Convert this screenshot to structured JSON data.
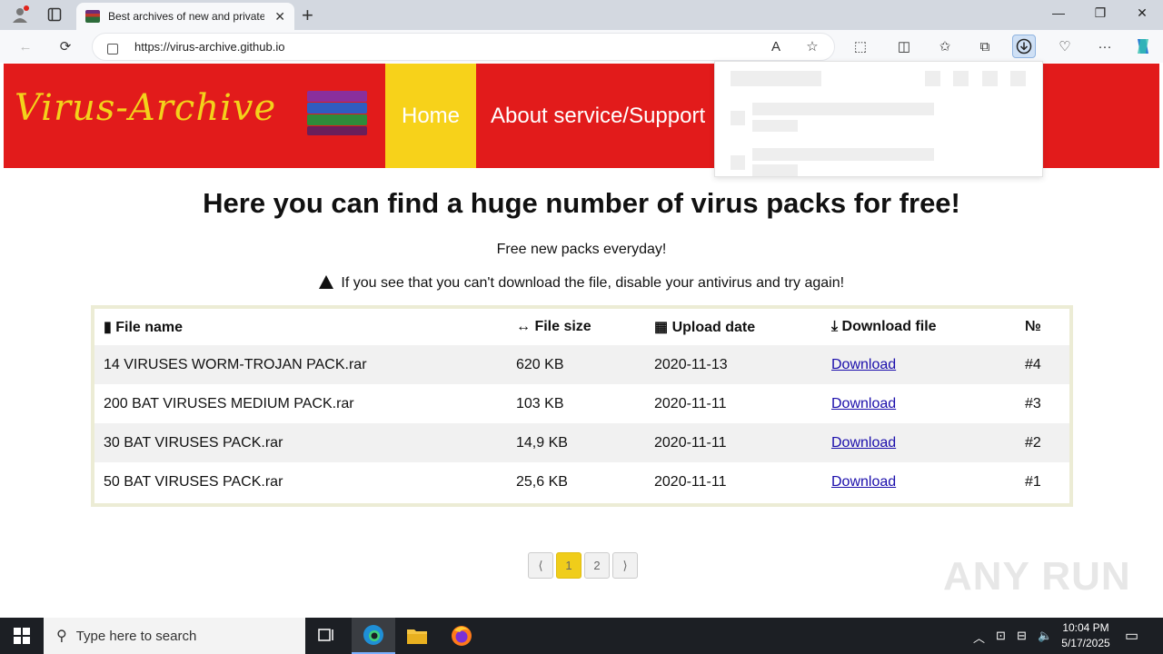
{
  "browser": {
    "tab_title": "Best archives of new and private",
    "url": "https://virus-archive.github.io"
  },
  "site": {
    "logo": "Virus-Archive",
    "nav": {
      "home": "Home",
      "about": "About service/Support"
    },
    "heading": "Here you can find a huge number of virus packs for free!",
    "subheading": "Free new packs everyday!",
    "warning": "If you see that you can't download the file, disable your antivirus and try again!",
    "table": {
      "headers": [
        "File name",
        "File size",
        "Upload date",
        "Download file",
        "№"
      ],
      "rows": [
        {
          "name": "14 VIRUSES WORM-TROJAN PACK.rar",
          "size": "620 KB",
          "date": "2020-11-13",
          "link": "Download",
          "num": "#4"
        },
        {
          "name": "200 BAT VIRUSES MEDIUM PACK.rar",
          "size": "103 KB",
          "date": "2020-11-11",
          "link": "Download",
          "num": "#3"
        },
        {
          "name": "30 BAT VIRUSES PACK.rar",
          "size": "14,9 KB",
          "date": "2020-11-11",
          "link": "Download",
          "num": "#2"
        },
        {
          "name": "50 BAT VIRUSES PACK.rar",
          "size": "25,6 KB",
          "date": "2020-11-11",
          "link": "Download",
          "num": "#1"
        }
      ]
    },
    "pager": {
      "prev": "⟨",
      "p1": "1",
      "p2": "2",
      "next": "⟩"
    },
    "watermark": "ANY RUN"
  },
  "taskbar": {
    "search_placeholder": "Type here to search",
    "time": "10:04 PM",
    "date": "5/17/2025"
  },
  "colors": {
    "header_red": "#e21b1b",
    "accent_yellow": "#f7d21a"
  }
}
